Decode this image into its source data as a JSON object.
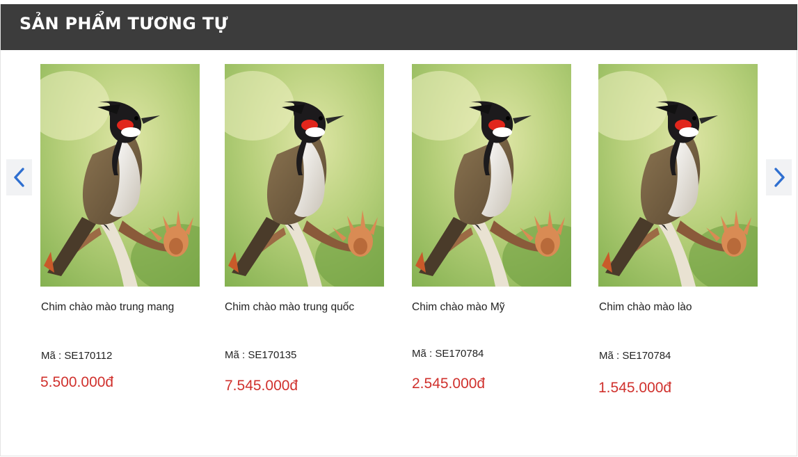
{
  "section": {
    "title": "SẢN PHẨM TƯƠNG TỰ"
  },
  "carousel": {
    "prev_icon": "chevron-left-icon",
    "next_icon": "chevron-right-icon",
    "accent_color": "#2f6fd0"
  },
  "products": [
    {
      "name": "Chim chào mào trung mang",
      "code": "Mã : SE170112",
      "price": "5.500.000đ"
    },
    {
      "name": "Chim chào mào trung quốc",
      "code": "Mã : SE170135",
      "price": "7.545.000đ"
    },
    {
      "name": "Chim chào mào Mỹ",
      "code": "Mã : SE170784",
      "price": "2.545.000đ"
    },
    {
      "name": "Chim chào mào lào",
      "code": "Mã : SE170784",
      "price": "1.545.000đ"
    }
  ],
  "colors": {
    "header_bg": "#3c3c3c",
    "price": "#d0312d"
  }
}
